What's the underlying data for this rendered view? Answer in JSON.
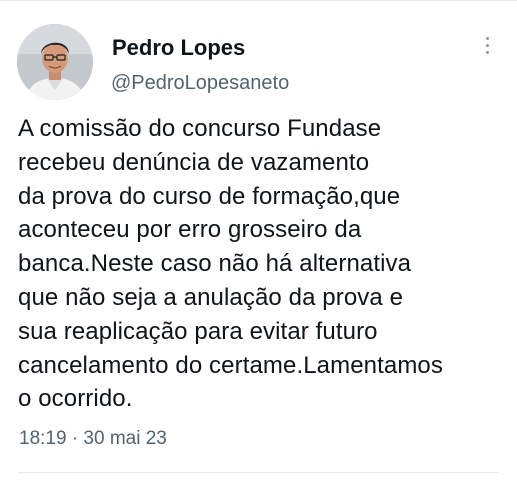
{
  "author": {
    "name": "Pedro Lopes",
    "handle": "@PedroLopesaneto",
    "avatar_icon": "profile-photo"
  },
  "tweet": {
    "text": "A comissão do concurso Fundase\nrecebeu denúncia de vazamento\nda prova do curso de formação,que\naconteceu por erro grosseiro da\nbanca.Neste caso não há alternativa\nque não seja a anulação da prova e\nsua reaplicação para evitar futuro\ncancelamento do certame.Lamentamos\no ocorrido.",
    "timestamp": "18:19 · 30 mai 23"
  },
  "colors": {
    "text_primary": "#0f1419",
    "text_secondary": "#536471",
    "background": "#ffffff"
  },
  "icons": {
    "more": "more-vertical-icon"
  }
}
